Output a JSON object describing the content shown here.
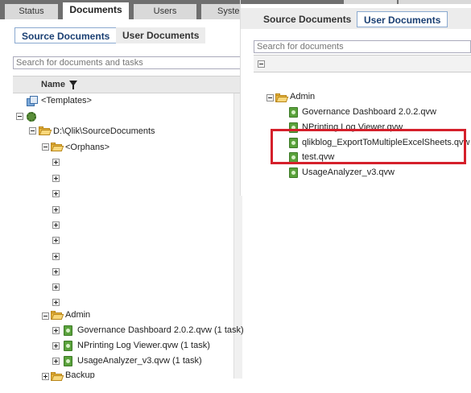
{
  "top_tabs": [
    {
      "label": "Status",
      "active": false
    },
    {
      "label": "Documents",
      "active": true
    },
    {
      "label": "Users",
      "active": false
    },
    {
      "label": "Syste",
      "active": false
    }
  ],
  "left_panel": {
    "subtabs": [
      {
        "label": "Source Documents",
        "active": true
      },
      {
        "label": "User Documents",
        "active": false
      }
    ],
    "search_placeholder": "Search for documents and tasks",
    "column_header": "Name",
    "tree": {
      "templates": "<Templates>",
      "server_root": "",
      "source_path": "D:\\Qlik\\SourceDocuments",
      "orphans": "<Orphans>",
      "admin": "Admin",
      "admin_children": [
        "Governance Dashboard 2.0.2.qvw (1 task)",
        "NPrinting Log Viewer.qvw (1 task)",
        "UsageAnalyzer_v3.qvw (1 task)"
      ],
      "backup": "Backup"
    }
  },
  "right_panel": {
    "subtabs": [
      {
        "label": "Source Documents",
        "active": false
      },
      {
        "label": "User Documents",
        "active": true
      }
    ],
    "search_placeholder": "Search for documents",
    "tree": {
      "admin": "Admin",
      "admin_children": [
        "Governance Dashboard 2.0.2.qvw",
        "NPrinting Log Viewer.qvw",
        "qlikblog_ExportToMultipleExcelSheets.qvw",
        "test.qvw",
        "UsageAnalyzer_v3.qvw"
      ]
    }
  },
  "colors": {
    "highlight_border": "#d5202b",
    "folder": "#e8b53c",
    "document": "#5aa23c",
    "active_tab_border": "#8aa9d0"
  }
}
